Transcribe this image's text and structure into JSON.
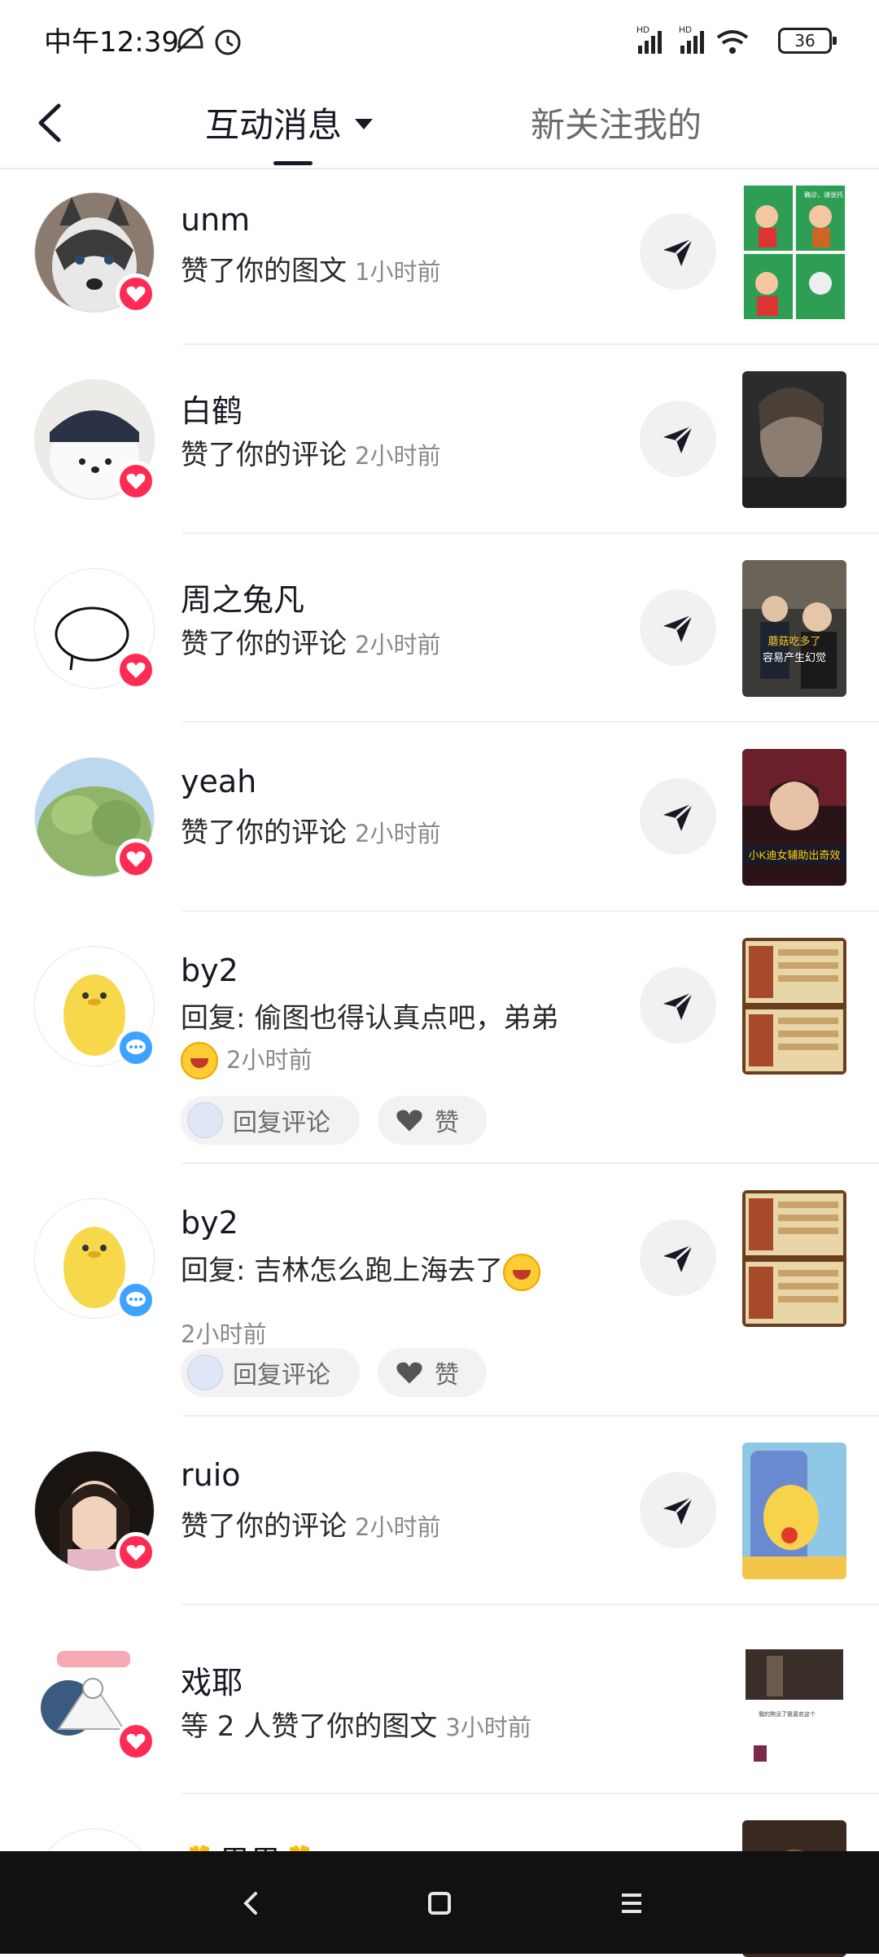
{
  "status_bar": {
    "time": "中午12:39",
    "battery": "36",
    "signal_label_1": "HD",
    "signal_label_2": "HD"
  },
  "header": {
    "tab_active": "互动消息",
    "tab_inactive": "新关注我的"
  },
  "notifications": [
    {
      "username": "unm",
      "action": "赞了你的图文",
      "time": "1小时前",
      "type": "like"
    },
    {
      "username": "白鹤",
      "action": "赞了你的评论",
      "time": "2小时前",
      "type": "like"
    },
    {
      "username": "周之兔凡",
      "action": "赞了你的评论",
      "time": "2小时前",
      "type": "like"
    },
    {
      "username": "yeah",
      "action": "赞了你的评论",
      "time": "2小时前",
      "type": "like"
    },
    {
      "username": "by2",
      "action": "回复: 偷图也得认真点吧，弟弟",
      "time": "2小时前",
      "type": "reply",
      "reply_label": "回复评论",
      "like_label": "赞"
    },
    {
      "username": "by2",
      "action": "回复: 吉林怎么跑上海去了",
      "time": "2小时前",
      "type": "reply",
      "reply_label": "回复评论",
      "like_label": "赞"
    },
    {
      "username": "ruio",
      "action": "赞了你的评论",
      "time": "2小时前",
      "type": "like"
    },
    {
      "username": "戏耶",
      "action": "等 2 人赞了你的图文",
      "time": "3小时前",
      "type": "like"
    },
    {
      "username": "🌼男男🌼",
      "action": "",
      "time": "",
      "type": "like"
    }
  ],
  "thumb_texts": {
    "t3_a": "蘑菇吃多了",
    "t3_b": "容易产生幻觉",
    "t4": "小K迪女辅助出奇效",
    "t1": "确诊，请张托",
    "t8": "我的狗没了我喜欢这个"
  },
  "colors": {
    "like_badge": "#fe2c55",
    "comment_badge": "#3ea3ff",
    "divider": "#efefef"
  }
}
